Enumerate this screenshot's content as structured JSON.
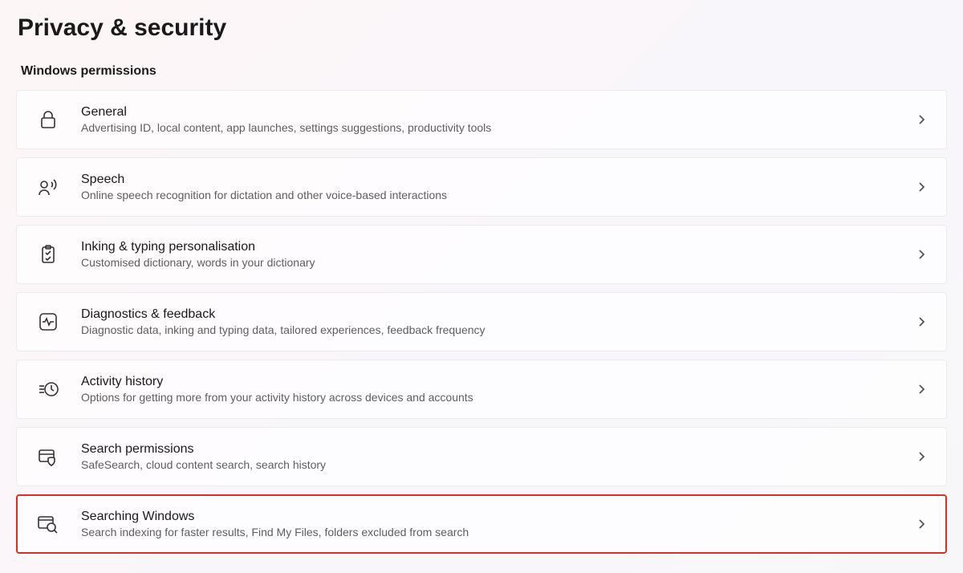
{
  "page_title": "Privacy & security",
  "section_header": "Windows permissions",
  "items": [
    {
      "title": "General",
      "description": "Advertising ID, local content, app launches, settings suggestions, productivity tools"
    },
    {
      "title": "Speech",
      "description": "Online speech recognition for dictation and other voice-based interactions"
    },
    {
      "title": "Inking & typing personalisation",
      "description": "Customised dictionary, words in your dictionary"
    },
    {
      "title": "Diagnostics & feedback",
      "description": "Diagnostic data, inking and typing data, tailored experiences, feedback frequency"
    },
    {
      "title": "Activity history",
      "description": "Options for getting more from your activity history across devices and accounts"
    },
    {
      "title": "Search permissions",
      "description": "SafeSearch, cloud content search, search history"
    },
    {
      "title": "Searching Windows",
      "description": "Search indexing for faster results, Find My Files, folders excluded from search"
    }
  ]
}
